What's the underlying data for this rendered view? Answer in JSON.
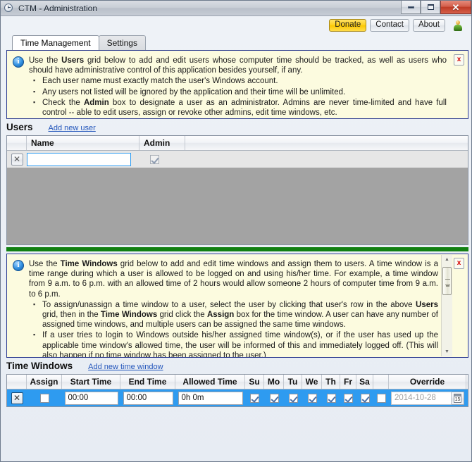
{
  "window": {
    "title": "CTM - Administration",
    "icon": "clock-icon",
    "buttons": {
      "minimize": "minimize",
      "maximize": "maximize",
      "close": "close"
    }
  },
  "topbar": {
    "donate": "Donate",
    "contact": "Contact",
    "about": "About",
    "user_icon": "user-icon"
  },
  "tabs": [
    {
      "label": "Time Management",
      "active": true
    },
    {
      "label": "Settings",
      "active": false
    }
  ],
  "users_info": {
    "icon": "info-icon",
    "close": "x",
    "paragraph_parts": {
      "p1a": "Use the ",
      "p1b": "Users",
      "p1c": " grid below to add and edit users whose computer time should be tracked, as well as users who should have administrative control of this application besides yourself, if any."
    },
    "bullets": [
      {
        "text": "Each user name must exactly match the user's Windows account."
      },
      {
        "text": "Any users not listed will be ignored by the application and their time will be unlimited."
      },
      {
        "pre": "Check the ",
        "strong": "Admin",
        "post": " box to designate a user as an administrator. Admins are never time-limited and have full control -- able to edit users, assign or revoke other admins, edit time windows, etc."
      }
    ]
  },
  "users_section": {
    "heading": "Users",
    "add_link": "Add new user",
    "columns": [
      "",
      "Name",
      "Admin",
      ""
    ],
    "rows": [
      {
        "delete": "✕",
        "name": "",
        "name_placeholder": "",
        "admin_checked": true
      }
    ]
  },
  "time_windows_info": {
    "icon": "info-icon",
    "close": "x",
    "paragraph_parts": {
      "p1a": "Use the ",
      "p1b": "Time Windows",
      "p1c": " grid below to add and edit time windows and assign them to users. A time window is a time range during which a user is allowed to be logged on and using his/her time. For example, a time window from 9 a.m. to 6 p.m. with an allowed time of 2 hours would allow someone 2 hours of computer time from 9 a.m. to 6 p.m."
    },
    "bullets": [
      {
        "pre": "To assign/unassign a time window to a user, select the user by clicking that user's row in the above ",
        "strong": "Users",
        "mid": " grid, then in the ",
        "strong2": "Time Windows",
        "mid2": " grid click the ",
        "strong3": "Assign",
        "post": " box for the time window. A user can have any number of assigned time windows, and multiple users can be assigned the same time windows."
      },
      {
        "text": "If a user tries to login to Windows outside his/her assigned time window(s), or if the user has used up the applicable time window's allowed time, the user will be informed of this and immediately logged off. (This will also happen if no time window has been assigned to the user.)"
      }
    ]
  },
  "time_windows_section": {
    "heading": "Time Windows",
    "add_link": "Add new time window",
    "columns": [
      "",
      "Assign",
      "Start Time",
      "End Time",
      "Allowed Time",
      "Su",
      "Mo",
      "Tu",
      "We",
      "Th",
      "Fr",
      "Sa",
      "",
      "Override",
      ""
    ],
    "rows": [
      {
        "delete": "✕",
        "assign_checked": false,
        "start_time": "00:00",
        "end_time": "00:00",
        "allowed_time": "0h 0m",
        "days": {
          "su": true,
          "mo": true,
          "tu": true,
          "we": true,
          "th": true,
          "fr": true,
          "sa": true
        },
        "override_checked": false,
        "override_date": "2014-10-28",
        "override_enabled": false,
        "calendar_day": "15"
      }
    ]
  },
  "colors": {
    "accent_blue": "#2e9bf0",
    "info_bg": "#fcfbdf",
    "info_border": "#2b3a8f",
    "donate_yellow": "#ffd21f",
    "divider_green": "#128012",
    "link_blue": "#2255bb"
  }
}
